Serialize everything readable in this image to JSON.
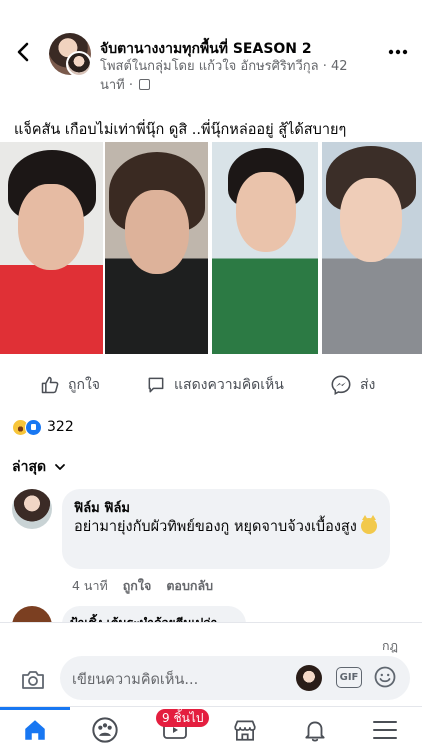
{
  "header": {
    "group_title": "จับตานางงามทุกพื้นที่ SEASON 2",
    "meta_prefix": "โพสต์ในกลุ่มโดย",
    "author": "แก้วใจ อักษรศิริทวีกุล",
    "time": "42 นาที",
    "back_icon": "back-arrow-icon",
    "more_icon": "more-dots-icon"
  },
  "post": {
    "text": "แจ็คสัน เกือบไม่เท่าพี่นุ๊ก ดูสิ ..พี่นุ๊กหล่ออยู่ สู้ได้สบายๆ",
    "photos": 4
  },
  "actions": {
    "like": "ถูกใจ",
    "comment": "แสดงความคิดเห็น",
    "share": "ส่ง"
  },
  "reactions": {
    "count": "322",
    "types": [
      "haha",
      "like"
    ]
  },
  "sort": {
    "label": "ล่าสุด"
  },
  "comments": [
    {
      "name": "ฟิล์ม ฟิล์ม",
      "text": "อย่ามายุ่งกับผัวทิพย์ของกู หยุดจาบจ้วงเบื้องสูง",
      "time": "4 นาที",
      "like": "ถูกใจ",
      "reply": "ตอบกลับ"
    },
    {
      "name": "ป้าเชิ้ง เต้นระบำด้วยตีนเปล่า"
    }
  ],
  "composer": {
    "corner_text": "กฎ",
    "placeholder": "เขียนความคิดเห็น...",
    "gif": "GIF"
  },
  "nav": {
    "badge": "9 ชิ้นไป",
    "items": [
      "home-icon",
      "groups-icon",
      "watch-icon",
      "marketplace-icon",
      "notifications-icon",
      "menu-icon"
    ]
  },
  "colors": {
    "accent": "#1877f2",
    "badge": "#e41e3f",
    "muted": "#65676b"
  }
}
